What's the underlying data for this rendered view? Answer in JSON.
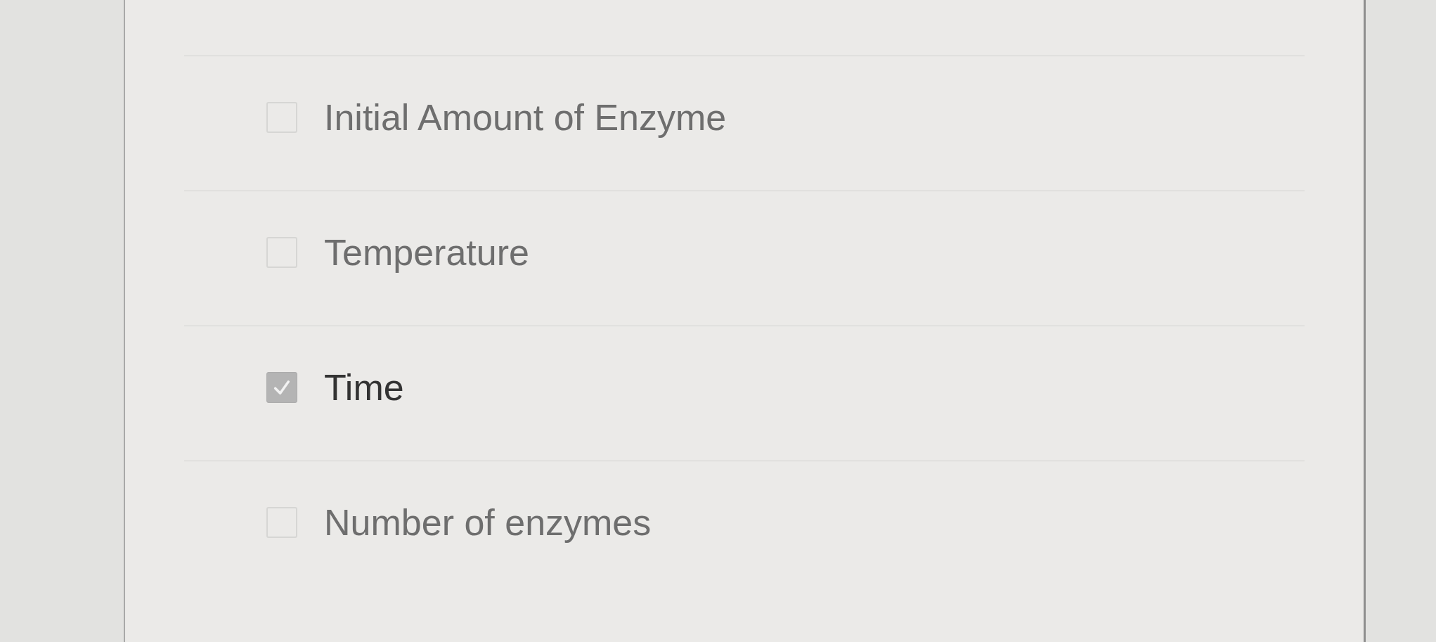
{
  "options": [
    {
      "label": "Initial Amount of Enzyme",
      "checked": false
    },
    {
      "label": "Temperature",
      "checked": false
    },
    {
      "label": "Time",
      "checked": true
    },
    {
      "label": "Number of enzymes",
      "checked": false
    }
  ]
}
